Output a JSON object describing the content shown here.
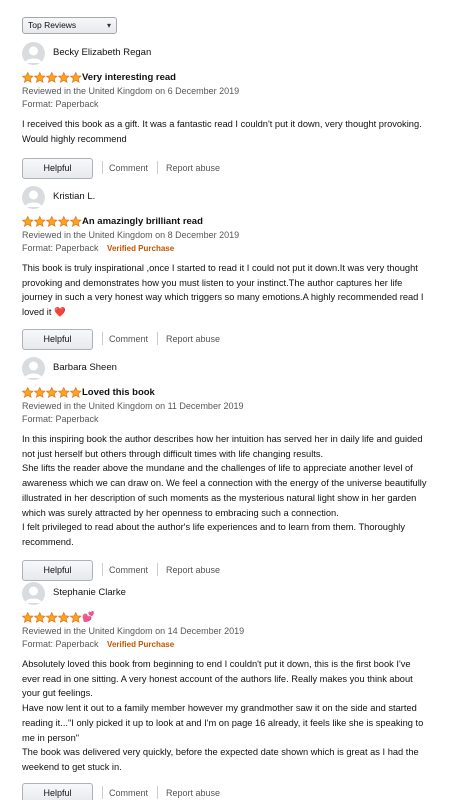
{
  "sort": {
    "label": "Top Reviews"
  },
  "labels": {
    "helpful": "Helpful",
    "comment": "Comment",
    "report": "Report abuse"
  },
  "colors": {
    "star": "#ffa41c",
    "verified": "#c45500",
    "link": "#555555"
  },
  "reviews": [
    {
      "name": "Becky Elizabeth Regan",
      "rating": 5,
      "title": "Very interesting read",
      "date": "Reviewed in the United Kingdom on 6 December 2019",
      "format": "Format: Paperback",
      "verified": "",
      "body": "I received this book as a gift. It was a fantastic read I couldn't put it down, very thought provoking. Would highly recommend"
    },
    {
      "name": "Kristian L.",
      "rating": 5,
      "title": "An amazingly brilliant read",
      "date": "Reviewed in the United Kingdom on 8 December 2019",
      "format": "Format: Paperback",
      "verified": "Verified Purchase",
      "body": "This book is truly inspirational ,once I started to read it I could not put it down.It was very thought provoking and demonstrates how you must listen to your instinct.The author captures her life journey in such a very honest way which triggers so many emotions.A highly recommended read I loved it ",
      "body_emoji": "❤️"
    },
    {
      "name": "Barbara Sheen",
      "rating": 5,
      "title": "Loved this book",
      "date": "Reviewed in the United Kingdom on 11 December 2019",
      "format": "Format: Paperback",
      "verified": "",
      "body": "In this inspiring book the author describes how her intuition has served her in daily life and guided not just herself but others through difficult times with life changing results.\nShe lifts the reader above the mundane and the challenges of life to appreciate another level of awareness which we can draw on. We feel a connection with the energy of the universe beautifully illustrated in her description of such moments as the mysterious natural light show in her garden which was surely attracted by her openness to embracing such a connection.\nI felt privileged to read about the author's life experiences and to learn from them. Thoroughly recommend."
    },
    {
      "name": "Stephanie Clarke",
      "rating": 5,
      "title": "💕",
      "date": "Reviewed in the United Kingdom on 14 December 2019",
      "format": "Format: Paperback",
      "verified": "Verified Purchase",
      "body": "Absolutely loved this book from beginning to end I couldn't put it down, this is the first book I've ever read in one sitting. A very honest account of the authors life. Really makes you think about your gut feelings.\nHave now lent it out to a family member however my grandmother saw it on the side and started reading it...\"I only picked it up to look at and I'm on page 16 already, it feels like she is speaking to me in person\"\nThe book was delivered very quickly, before the expected date shown which is great as I had the weekend to get stuck in."
    }
  ]
}
